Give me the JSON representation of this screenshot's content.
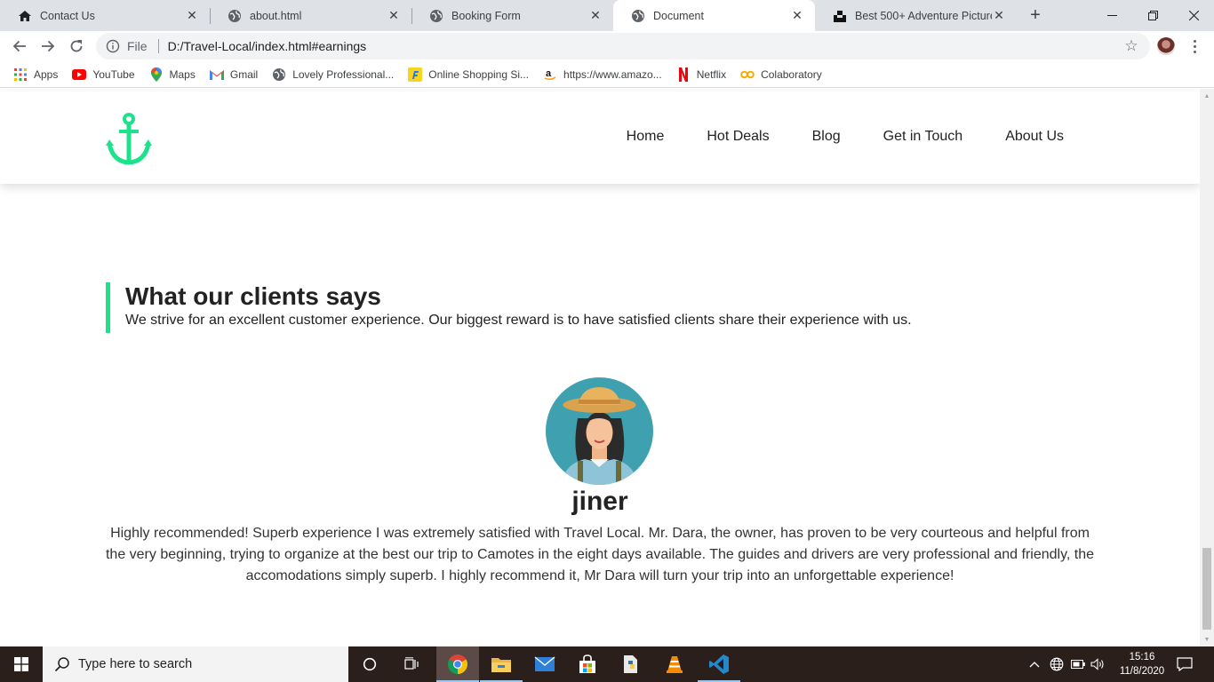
{
  "browser": {
    "tabs": [
      {
        "title": "Contact Us",
        "icon": "home-icon"
      },
      {
        "title": "about.html",
        "icon": "globe-icon"
      },
      {
        "title": "Booking Form",
        "icon": "globe-icon"
      },
      {
        "title": "Document",
        "icon": "globe-icon",
        "active": true
      },
      {
        "title": "Best 500+ Adventure Pictures [",
        "icon": "unsplash-icon"
      }
    ],
    "address": {
      "scheme": "File",
      "url": "D:/Travel-Local/index.html#earnings"
    },
    "bookmarks": [
      {
        "label": "Apps",
        "icon": "apps-grid-icon"
      },
      {
        "label": "YouTube",
        "icon": "youtube-icon"
      },
      {
        "label": "Maps",
        "icon": "maps-pin-icon"
      },
      {
        "label": "Gmail",
        "icon": "gmail-icon"
      },
      {
        "label": "Lovely Professional...",
        "icon": "globe-icon"
      },
      {
        "label": "Online Shopping Si...",
        "icon": "flipkart-icon"
      },
      {
        "label": "https://www.amazo...",
        "icon": "amazon-icon"
      },
      {
        "label": "Netflix",
        "icon": "netflix-icon"
      },
      {
        "label": "Colaboratory",
        "icon": "colab-icon"
      }
    ]
  },
  "site": {
    "nav": [
      "Home",
      "Hot Deals",
      "Blog",
      "Get in Touch",
      "About Us"
    ],
    "accent_color": "#1de28c",
    "section": {
      "title": "What our clients says",
      "subtitle": "We strive for an excellent customer experience. Our biggest reward is to have satisfied clients share their experience with us."
    },
    "testimonial": {
      "name": "jiner",
      "text": "Highly recommended! Superb experience I was extremely satisfied with Travel Local. Mr. Dara, the owner, has proven to be very courteous and helpful from the very beginning, trying to organize at the best our trip to Camotes in the eight days available. The guides and drivers are very professional and friendly, the accomodations simply superb. I highly recommend it, Mr Dara will turn your trip into an unforgettable experience!"
    }
  },
  "taskbar": {
    "search_placeholder": "Type here to search",
    "time": "15:16",
    "date": "11/8/2020"
  }
}
